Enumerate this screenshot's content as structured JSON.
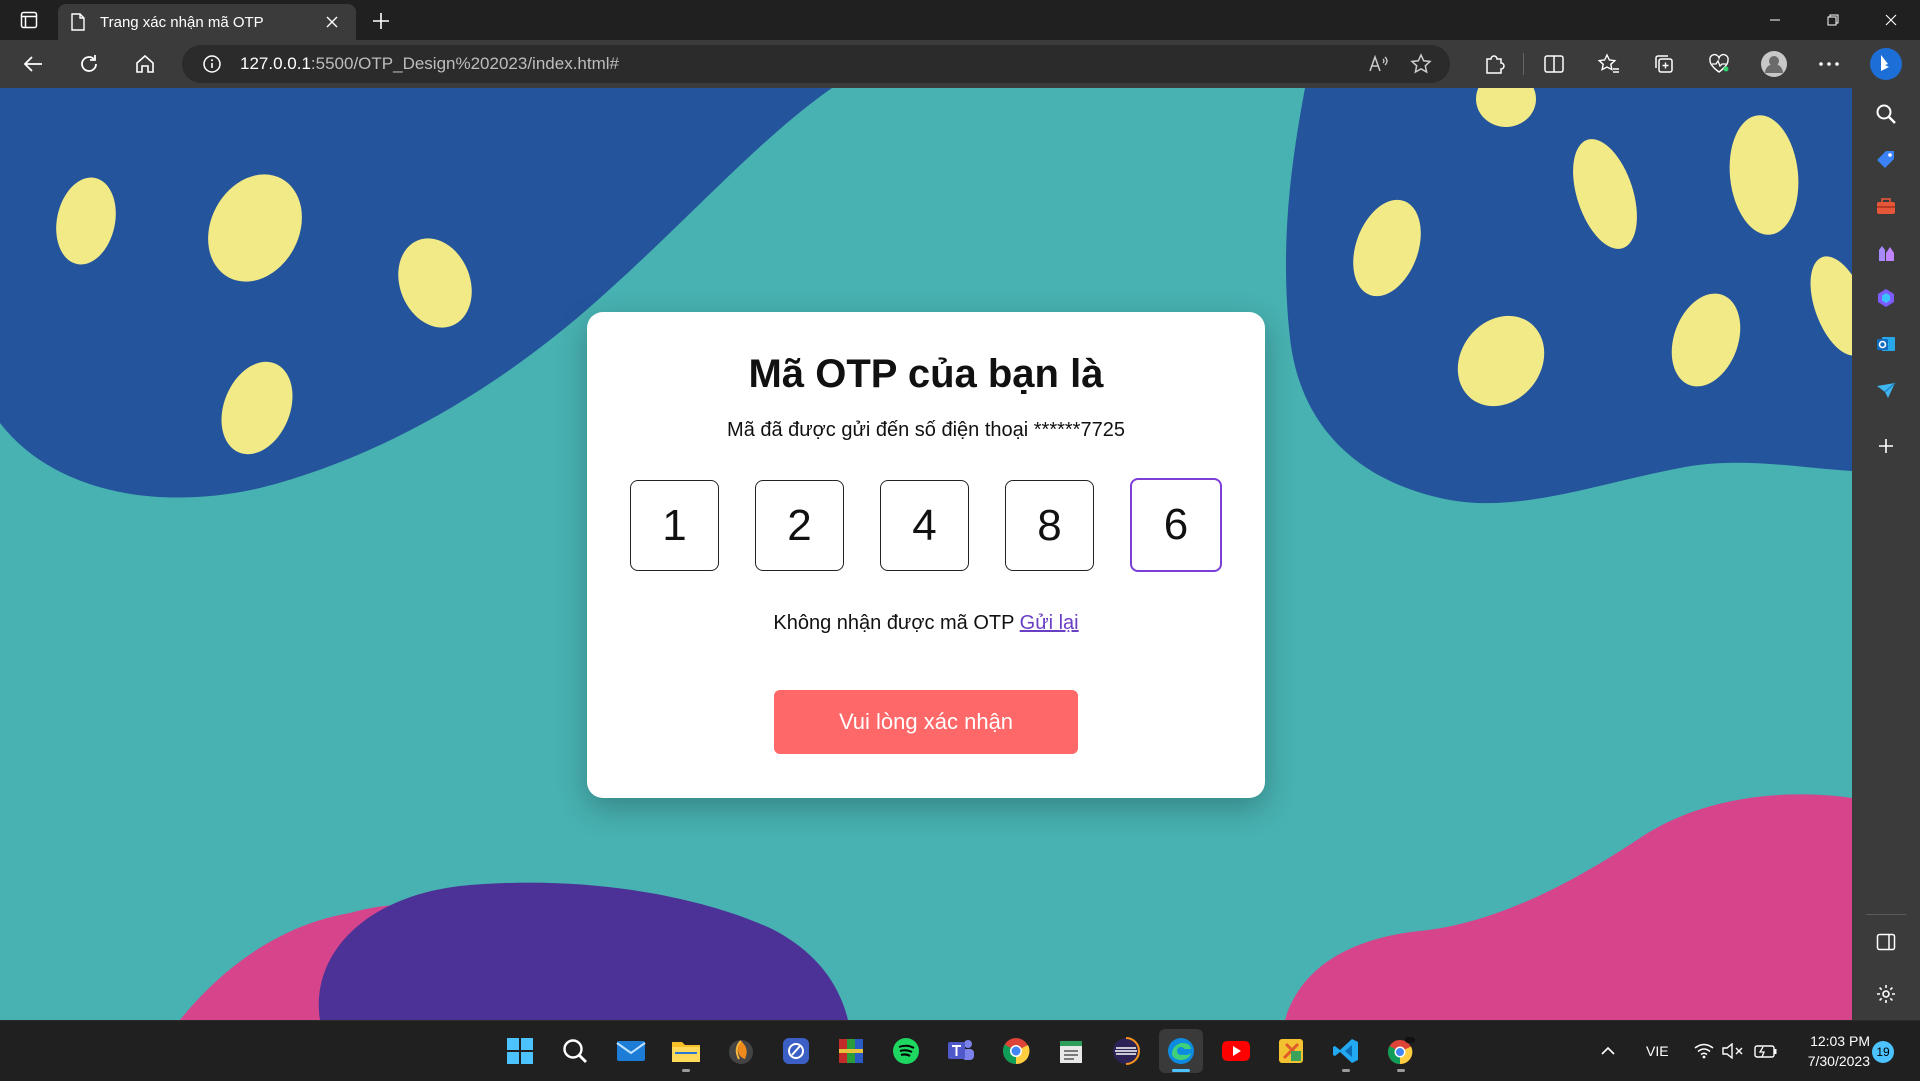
{
  "browser": {
    "tab_title": "Trang xác nhận mã OTP",
    "url_host": "127.0.0.1",
    "url_path": ":5500/OTP_Design%202023/index.html#"
  },
  "page": {
    "heading": "Mã OTP của bạn là",
    "subtitle": "Mã đã được gửi đến số điện thoại ******7725",
    "otp_digits": [
      "1",
      "2",
      "4",
      "8",
      "6"
    ],
    "resend_text": "Không nhận được mã OTP",
    "resend_link": "Gửi lại",
    "confirm_label": "Vui lòng xác nhận"
  },
  "taskbar": {
    "language": "VIE",
    "time": "12:03 PM",
    "date": "7/30/2023",
    "notification_count": "19"
  },
  "colors": {
    "page_bg": "#48b1b1",
    "blob_blue": "#24549c",
    "dot_yellow": "#f2ea86",
    "blob_pink": "#d6448c",
    "blob_purple": "#4c3296",
    "button": "#ff6868",
    "active_box": "#7b3fd6"
  }
}
